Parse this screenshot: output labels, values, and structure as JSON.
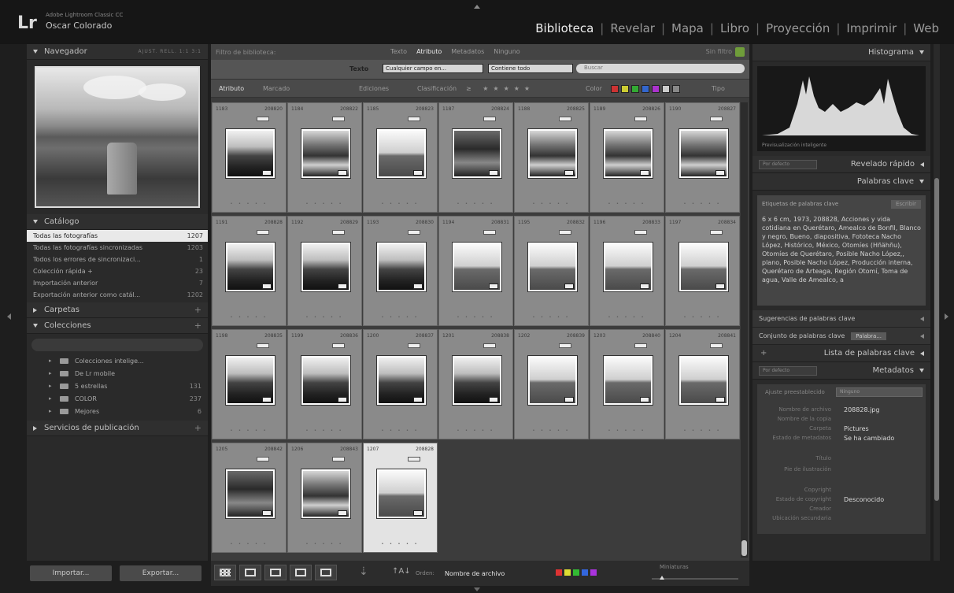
{
  "identity": {
    "logo": "Lr",
    "app_small": "Adobe Lightroom Classic CC",
    "user": "Oscar Colorado"
  },
  "modules": [
    {
      "label": "Biblioteca",
      "active": true
    },
    {
      "label": "Revelar"
    },
    {
      "label": "Mapa"
    },
    {
      "label": "Libro"
    },
    {
      "label": "Proyección"
    },
    {
      "label": "Imprimir"
    },
    {
      "label": "Web"
    }
  ],
  "module_separator": "|",
  "left": {
    "navigator": {
      "title": "Navegador",
      "options": "AJUST. RELL. 1:1 3:1"
    },
    "catalog": {
      "title": "Catálogo",
      "items": [
        {
          "label": "Todas las fotografías",
          "count": "1207",
          "selected": true
        },
        {
          "label": "Todas las fotografías sincronizadas",
          "count": "1203"
        },
        {
          "label": "Todos los errores de sincronizaci...",
          "count": "1"
        },
        {
          "label": "Colección rápida +",
          "count": "23"
        },
        {
          "label": "Importación anterior",
          "count": "7"
        },
        {
          "label": "Exportación anterior como catál...",
          "count": "1202"
        }
      ]
    },
    "folders": {
      "title": "Carpetas",
      "plus": "+"
    },
    "collections": {
      "title": "Colecciones",
      "plus": "+",
      "items": [
        {
          "label": "Colecciones intelige...",
          "count": ""
        },
        {
          "label": "De Lr mobile",
          "count": ""
        },
        {
          "label": "5 estrellas",
          "count": "131"
        },
        {
          "label": "COLOR",
          "count": "237"
        },
        {
          "label": "Mejores",
          "count": "6"
        }
      ]
    },
    "publish": {
      "title": "Servicios de publicación",
      "plus": "+"
    },
    "import_label": "Importar...",
    "export_label": "Exportar..."
  },
  "filter": {
    "title": "Filtro de biblioteca:",
    "tabs": [
      "Texto",
      "Atributo",
      "Metadatos",
      "Ninguno"
    ],
    "active_tab": "Atributo",
    "preset": "Sin filtro",
    "text_label": "Texto",
    "text_field": "Cualquier campo en...",
    "text_rule": "Contiene todo",
    "search_placeholder": "Buscar",
    "attr_label": "Atributo",
    "attr_marked": "Marcado",
    "attr_edits": "Ediciones",
    "attr_rating": "Clasificación",
    "attr_color": "Color",
    "attr_type": "Tipo",
    "color_swatches": [
      "#c33",
      "#cc3",
      "#3a3",
      "#36c",
      "#a3c",
      "#ccc",
      "#888"
    ]
  },
  "grid": {
    "cells": [
      {
        "idx": "1183",
        "num": "208820"
      },
      {
        "idx": "1184",
        "num": "208822"
      },
      {
        "idx": "1185",
        "num": "208823"
      },
      {
        "idx": "1187",
        "num": "208824"
      },
      {
        "idx": "1188",
        "num": "208825"
      },
      {
        "idx": "1189",
        "num": "208826"
      },
      {
        "idx": "1190",
        "num": "208827"
      },
      {
        "idx": "1191",
        "num": "208828"
      },
      {
        "idx": "1192",
        "num": "208829"
      },
      {
        "idx": "1193",
        "num": "208830"
      },
      {
        "idx": "1194",
        "num": "208831"
      },
      {
        "idx": "1195",
        "num": "208832"
      },
      {
        "idx": "1196",
        "num": "208833"
      },
      {
        "idx": "1197",
        "num": "208834"
      },
      {
        "idx": "1198",
        "num": "208835"
      },
      {
        "idx": "1199",
        "num": "208836"
      },
      {
        "idx": "1200",
        "num": "208837"
      },
      {
        "idx": "1201",
        "num": "208838"
      },
      {
        "idx": "1202",
        "num": "208839"
      },
      {
        "idx": "1203",
        "num": "208840"
      },
      {
        "idx": "1204",
        "num": "208841"
      },
      {
        "idx": "1205",
        "num": "208842"
      },
      {
        "idx": "1206",
        "num": "208843"
      },
      {
        "idx": "1207",
        "num": "208828"
      }
    ],
    "stars": "• • • • •"
  },
  "toolbar": {
    "sort_label": "Orden:",
    "sort_value": "Nombre de archivo",
    "labels": [
      "#d33",
      "#dd3",
      "#3b3",
      "#36d",
      "#a3d"
    ],
    "thumb_label": "Miniaturas"
  },
  "right": {
    "histogram": {
      "title": "Histograma",
      "caption": "Previsualización inteligente"
    },
    "quick_develop": {
      "title": "Revelado rápido",
      "preset": "Por defecto"
    },
    "keywords": {
      "title": "Palabras clave",
      "tags_label": "Etiquetas de palabras clave",
      "tags_mode": "Escribir",
      "text": "6 x 6 cm, 1973, 208828, Acciones y vida cotidiana en Querétaro, Amealco de Bonfil, Blanco y negro, Bueno, diapositiva, Fototeca Nacho López, Histórico, México, Otomíes (Hñähñu), Otomíes de Querétaro, Posible Nacho López,, plano, Posible Nacho López, Producción interna, Querétaro de Arteaga, Región Otomí, Toma de agua, Valle de Amealco, a",
      "suggestions": "Sugerencias de palabras clave",
      "set_label": "Conjunto de palabras clave",
      "set_value": "Palabra..."
    },
    "keyword_list": {
      "title": "Lista de palabras clave",
      "plus": "+"
    },
    "metadata": {
      "title": "Metadatos",
      "preset": "Por defecto",
      "ajuste_label": "Ajuste preestablecido",
      "ajuste_value": "Ninguno",
      "rows": [
        {
          "k": "Nombre de archivo",
          "v": "208828.jpg"
        },
        {
          "k": "Nombre de la copia",
          "v": ""
        },
        {
          "k": "Carpeta",
          "v": "Pictures"
        },
        {
          "k": "Estado de metadatos",
          "v": "Se ha cambiado"
        },
        {
          "k": "Título",
          "v": ""
        },
        {
          "k": "Pie de ilustración",
          "v": ""
        },
        {
          "k": "Copyright",
          "v": ""
        },
        {
          "k": "Estado de copyright",
          "v": "Desconocido"
        },
        {
          "k": "Creador",
          "v": ""
        },
        {
          "k": "Ubicación secundaria",
          "v": ""
        }
      ]
    }
  }
}
